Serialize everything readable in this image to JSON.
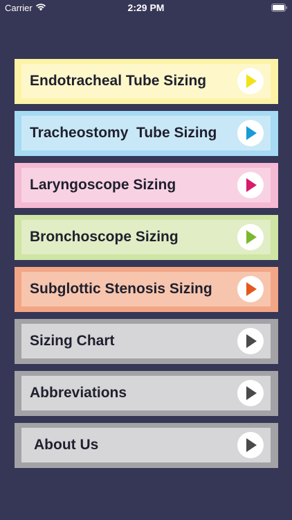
{
  "status_bar": {
    "carrier": "Carrier",
    "time": "2:29 PM"
  },
  "menu": {
    "items": [
      {
        "label": "Endotracheal Tube Sizing",
        "arrow_color": "#f2e21a"
      },
      {
        "label": "Tracheostomy  Tube Sizing",
        "arrow_color": "#1a9ad6"
      },
      {
        "label": "Laryngoscope Sizing",
        "arrow_color": "#d81b6a"
      },
      {
        "label": "Bronchoscope Sizing",
        "arrow_color": "#7cb82f"
      },
      {
        "label": "Subglottic Stenosis Sizing",
        "arrow_color": "#e5581d"
      },
      {
        "label": "Sizing Chart",
        "arrow_color": "#4a4a4a"
      },
      {
        "label": "Abbreviations",
        "arrow_color": "#4a4a4a"
      },
      {
        "label": "About Us",
        "arrow_color": "#4a4a4a"
      }
    ]
  }
}
